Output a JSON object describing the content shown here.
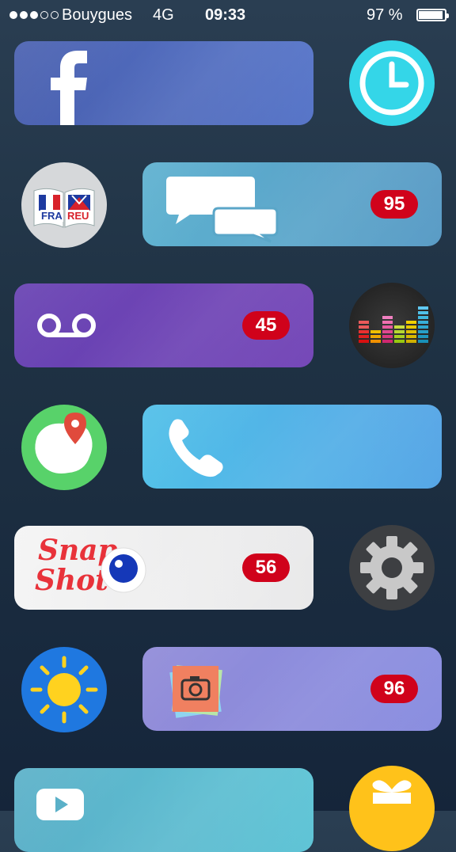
{
  "status_bar": {
    "carrier": "Bouygues",
    "network": "4G",
    "time": "09:33",
    "battery": "97 %",
    "signal_bars_filled": 3,
    "signal_bars_total": 5
  },
  "apps": {
    "facebook": {
      "icon": "facebook-icon",
      "color": "#4a66b5"
    },
    "clock": {
      "icon": "clock-icon",
      "color": "#34d6e8"
    },
    "dictionary": {
      "icon": "dictionary-icon",
      "left_label": "FRA",
      "right_label": "REU"
    },
    "messages": {
      "icon": "speech-bubbles-icon",
      "badge": "95",
      "color": "#5aa9c6"
    },
    "voicemail": {
      "icon": "voicemail-icon",
      "badge": "45",
      "color": "#6a42b4"
    },
    "deezer": {
      "icon": "equalizer-icon"
    },
    "maps": {
      "icon": "map-pin-icon",
      "color": "#58d26a"
    },
    "phone": {
      "icon": "phone-icon",
      "color": "#4fb6e6"
    },
    "snapshot": {
      "icon": "snapshot-icon",
      "title_line1": "Snap",
      "title_line2": "Shot",
      "badge": "56"
    },
    "settings": {
      "icon": "gear-icon"
    },
    "weather": {
      "icon": "sun-icon",
      "color": "#1f78e0"
    },
    "photos": {
      "icon": "camera-icon",
      "badge": "96",
      "color": "#8a86d8"
    },
    "video": {
      "icon": "play-icon"
    },
    "gift": {
      "icon": "gift-icon"
    }
  }
}
